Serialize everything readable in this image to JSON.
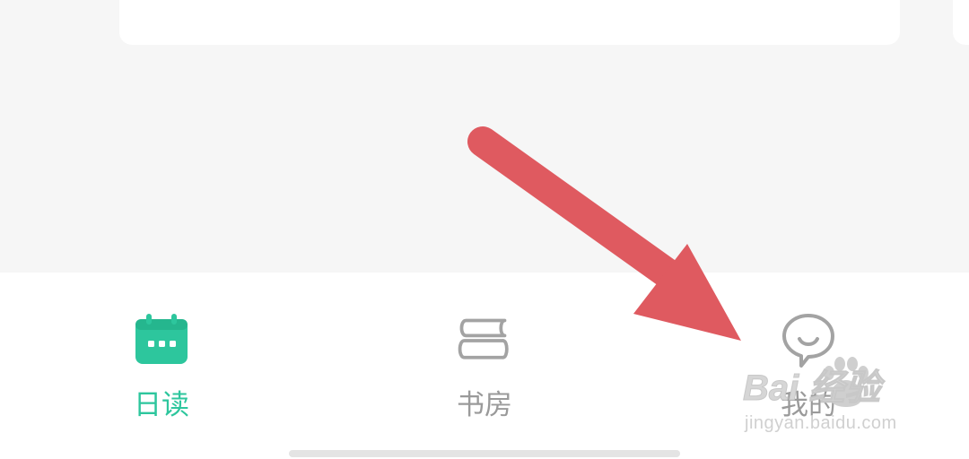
{
  "tabs": [
    {
      "label": "日读",
      "icon": "calendar-icon",
      "active": true
    },
    {
      "label": "书房",
      "icon": "books-icon",
      "active": false
    },
    {
      "label": "我的",
      "icon": "profile-icon",
      "active": false
    }
  ],
  "watermark": {
    "text": "Bai 经验",
    "url": "jingyan.baidu.com"
  },
  "colors": {
    "accent": "#2dc69d",
    "inactive": "#9a9a9a",
    "annotation_arrow": "#df5a60",
    "background": "#f6f6f6"
  }
}
